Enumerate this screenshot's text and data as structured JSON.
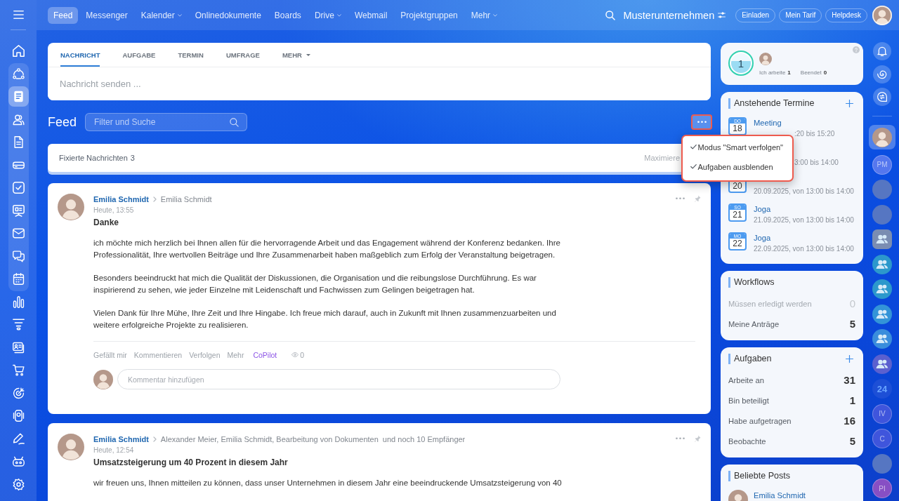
{
  "sidebar": {
    "top_items": [
      {
        "kind": "home",
        "selected": false
      }
    ],
    "pinned_items": [
      {
        "kind": "cycle",
        "selected": false
      },
      {
        "kind": "feed",
        "selected": true
      },
      {
        "kind": "people",
        "selected": false
      },
      {
        "kind": "document",
        "selected": false
      },
      {
        "kind": "drive",
        "selected": false
      },
      {
        "kind": "task",
        "selected": false
      },
      {
        "kind": "board",
        "selected": false
      },
      {
        "kind": "mail",
        "selected": false
      },
      {
        "kind": "chat",
        "selected": false
      },
      {
        "kind": "calendar",
        "selected": false
      }
    ],
    "more_items": [
      {
        "kind": "chart",
        "selected": false
      },
      {
        "kind": "funnel",
        "selected": false
      },
      {
        "kind": "contact",
        "selected": false
      },
      {
        "kind": "cart",
        "selected": false
      },
      {
        "kind": "target",
        "selected": false
      },
      {
        "kind": "device",
        "selected": false
      },
      {
        "kind": "pen",
        "selected": false
      },
      {
        "kind": "robot",
        "selected": false
      },
      {
        "kind": "settings",
        "selected": false
      }
    ]
  },
  "topbar": {
    "nav": [
      {
        "label": "Feed",
        "selected": true,
        "dropdown": false
      },
      {
        "label": "Messenger",
        "selected": false,
        "dropdown": false
      },
      {
        "label": "Kalender",
        "selected": false,
        "dropdown": true
      },
      {
        "label": "Onlinedokumente",
        "selected": false,
        "dropdown": false
      },
      {
        "label": "Boards",
        "selected": false,
        "dropdown": false
      },
      {
        "label": "Drive",
        "selected": false,
        "dropdown": true
      },
      {
        "label": "Webmail",
        "selected": false,
        "dropdown": false
      },
      {
        "label": "Projektgruppen",
        "selected": false,
        "dropdown": false
      },
      {
        "label": "Mehr",
        "selected": false,
        "dropdown": true
      }
    ],
    "company": "Musterunternehmen",
    "buttons": [
      "Einladen",
      "Mein Tarif",
      "Helpdesk"
    ]
  },
  "composer": {
    "tabs": [
      {
        "label": "NACHRICHT",
        "selected": true,
        "dropdown": false
      },
      {
        "label": "AUFGABE",
        "selected": false,
        "dropdown": false
      },
      {
        "label": "TERMIN",
        "selected": false,
        "dropdown": false
      },
      {
        "label": "UMFRAGE",
        "selected": false,
        "dropdown": false
      },
      {
        "label": "MEHR",
        "selected": false,
        "dropdown": true
      }
    ],
    "placeholder": "Nachricht senden ..."
  },
  "feed_header": {
    "title": "Feed",
    "search": {
      "placeholder": "Filter und Suche"
    },
    "more_button": {
      "highlighted": true
    }
  },
  "feed_menu": {
    "highlighted": true,
    "items": [
      {
        "label": "Modus \"Smart verfolgen\"",
        "checked": true
      },
      {
        "label": "Aufgaben ausblenden",
        "checked": true
      }
    ]
  },
  "pinned": {
    "label": "Fixierte Nachrichten",
    "count": "3",
    "action": "Maximiere"
  },
  "posts": [
    {
      "author": "Emilia Schmidt",
      "recipients": "Emilia Schmidt",
      "time": "Heute, 13:55",
      "title": "Danke",
      "paragraphs": [
        "ich möchte mich herzlich bei Ihnen allen für die hervorragende Arbeit und das Engagement während der Konferenz bedanken. Ihre Professionalität, Ihre wertvollen Beiträge und Ihre Zusammenarbeit haben maßgeblich zum Erfolg der Veranstaltung beigetragen.",
        "Besonders beeindruckt hat mich die Qualität der Diskussionen, die Organisation und die reibungslose Durchführung. Es war inspirierend zu sehen, wie jeder Einzelne mit Leidenschaft und Fachwissen zum Gelingen beigetragen hat.",
        "Vielen Dank für Ihre Mühe, Ihre Zeit und Ihre Hingabe. Ich freue mich darauf, auch in Zukunft mit Ihnen zusammenzuarbeiten und weitere erfolgreiche Projekte zu realisieren."
      ],
      "actions": [
        {
          "label": "Gefällt mir",
          "kind": "plain"
        },
        {
          "label": "Kommentieren",
          "kind": "plain"
        },
        {
          "label": "Verfolgen",
          "kind": "plain"
        },
        {
          "label": "Mehr",
          "kind": "plain"
        },
        {
          "label": "CoPilot",
          "kind": "copilot"
        }
      ],
      "views": "0",
      "comment": {
        "placeholder": "Kommentar hinzufügen"
      }
    },
    {
      "author": "Emilia Schmidt",
      "recipients": "Alexander Meier, Emilia Schmidt, Bearbeitung von Dokumenten",
      "more_recipients": "und noch 10 Empfänger",
      "time": "Heute, 12:54",
      "title": "Umsatzsteigerung um 40 Prozent in diesem Jahr",
      "paragraphs": [
        "wir freuen uns, Ihnen mitteilen zu können, dass unser Unternehmen in diesem Jahr eine beeindruckende Umsatzsteigerung von 40"
      ]
    }
  ],
  "widgets": {
    "status": {
      "count": "1",
      "working_label": "Ich arbeite",
      "working": "1",
      "done_label": "Beendet",
      "done": "0"
    },
    "events": {
      "title": "Anstehende Termine",
      "add_button": true,
      "items": [
        {
          "weekday": "DO",
          "day": "18",
          "title": "Meeting",
          "time": ":20 bis 15:20"
        },
        {
          "time": "3:00 bis 14:00"
        },
        {
          "day": "20",
          "time": "20.09.2025, von 13:00 bis 14:00"
        },
        {
          "weekday": "SO",
          "day": "21",
          "title": "Joga",
          "time": "21.09.2025, von 13:00 bis 14:00"
        },
        {
          "weekday": "MO",
          "day": "22",
          "title": "Joga",
          "time": "22.09.2025, von 13:00 bis 14:00"
        }
      ]
    },
    "workflows": {
      "title": "Workflows",
      "add_button": false,
      "rows": [
        {
          "label": "Müssen erledigt werden",
          "value": "0",
          "disabled": true
        },
        {
          "label": "Meine Anträge",
          "value": "5",
          "disabled": false
        }
      ]
    },
    "tasks": {
      "title": "Aufgaben",
      "add_button": true,
      "rows": [
        {
          "label": "Arbeite an",
          "value": "31",
          "disabled": false
        },
        {
          "label": "Bin beteiligt",
          "value": "1",
          "disabled": false
        },
        {
          "label": "Habe aufgetragen",
          "value": "16",
          "disabled": false
        },
        {
          "label": "Beobachte",
          "value": "5",
          "disabled": false
        }
      ]
    },
    "popular": {
      "title": "Beliebte Posts",
      "add_button": false,
      "items": [
        {
          "author": "Emilia Schmidt"
        }
      ]
    }
  },
  "right_rail": {
    "tools": [
      {
        "kind": "bell"
      },
      {
        "kind": "spiral"
      },
      {
        "kind": "chatswap"
      }
    ],
    "contacts": [
      {
        "kind": "user",
        "selected": true
      },
      {
        "kind": "initials",
        "label": "PM",
        "color": "#5577ee",
        "selected": false
      },
      {
        "kind": "photo",
        "selected": false
      },
      {
        "kind": "photo",
        "selected": false
      },
      {
        "kind": "workgroup",
        "color": "#7a8db2",
        "selected": false
      },
      {
        "kind": "group",
        "color": "#2c98cc",
        "selected": false
      },
      {
        "kind": "group",
        "color": "#2c98cc",
        "selected": false
      },
      {
        "kind": "group",
        "color": "#3394d8",
        "selected": false
      },
      {
        "kind": "group",
        "color": "#3a8ddc",
        "selected": false
      },
      {
        "kind": "group",
        "color": "#5b60cf",
        "selected": false
      },
      {
        "kind": "logo",
        "label": "24",
        "color": "#1d4fd6",
        "selected": false
      },
      {
        "kind": "initials",
        "label": "IV",
        "color": "#3f55dc",
        "selected": false
      },
      {
        "kind": "initials",
        "label": "C",
        "color": "#3f55dc",
        "selected": false
      },
      {
        "kind": "photo",
        "selected": false
      },
      {
        "kind": "initials",
        "label": "PI",
        "color": "#874fc4",
        "selected": false
      }
    ]
  }
}
